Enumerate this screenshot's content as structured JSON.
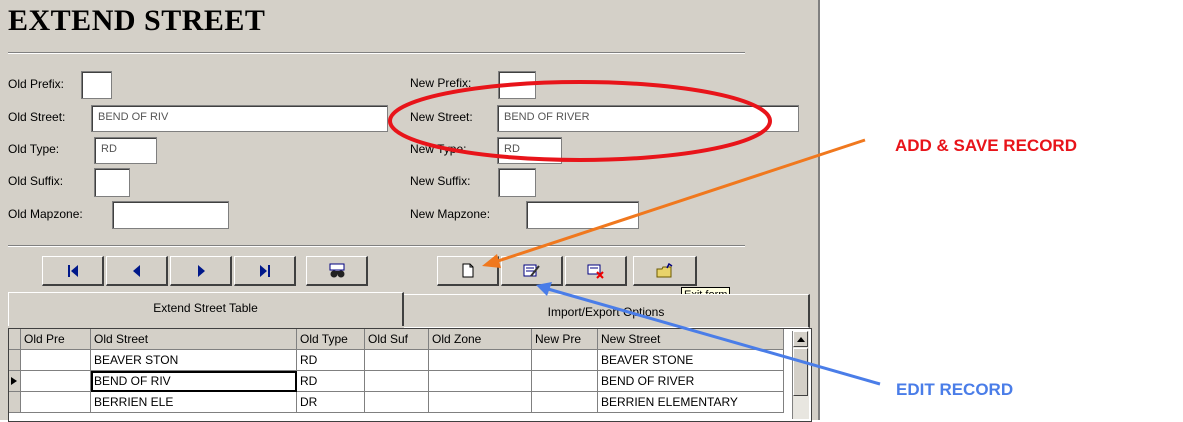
{
  "form": {
    "title": "EXTEND STREET",
    "old": {
      "prefix_label": "Old Prefix:",
      "prefix_value": "",
      "street_label": "Old Street:",
      "street_value": "BEND OF RIV",
      "type_label": "Old Type:",
      "type_value": "RD",
      "suffix_label": "Old Suffix:",
      "suffix_value": "",
      "mapzone_label": "Old Mapzone:",
      "mapzone_value": ""
    },
    "new": {
      "prefix_label": "New Prefix:",
      "prefix_value": "",
      "street_label": "New Street:",
      "street_value": "BEND OF RIVER",
      "type_label": "New Type:",
      "type_value": "RD",
      "suffix_label": "New Suffix:",
      "suffix_value": "",
      "mapzone_label": "New Mapzone:",
      "mapzone_value": ""
    }
  },
  "toolbar": {
    "first_icon": "first-record-icon",
    "prev_icon": "previous-record-icon",
    "next_icon": "next-record-icon",
    "last_icon": "last-record-icon",
    "find_icon": "find-binoculars-icon",
    "new_icon": "new-record-icon",
    "edit_icon": "edit-record-icon",
    "delete_icon": "delete-record-icon",
    "exit_icon": "exit-folder-icon",
    "tooltip": "Exit form"
  },
  "tabs": [
    {
      "label": "Extend Street Table"
    },
    {
      "label": "Import/Export Options"
    }
  ],
  "grid": {
    "columns": [
      "Old Pre",
      "Old Street",
      "Old Type",
      "Old Suf",
      "Old Zone",
      "New Pre",
      "New Street"
    ],
    "rows": [
      [
        "",
        "BEAVER STON",
        "RD",
        "",
        "",
        "",
        "BEAVER STONE"
      ],
      [
        "",
        "BEND OF RIV",
        "RD",
        "",
        "",
        "",
        "BEND OF RIVER"
      ],
      [
        "",
        "BERRIEN ELE",
        "DR",
        "",
        "",
        "",
        "BERRIEN ELEMENTARY"
      ]
    ],
    "current_row": 1
  },
  "annotations": {
    "add_save": "ADD & SAVE RECORD",
    "edit": "EDIT RECORD",
    "colors": {
      "red": "#e8141a",
      "orange": "#f0781e",
      "blue": "#4a7de8"
    }
  }
}
